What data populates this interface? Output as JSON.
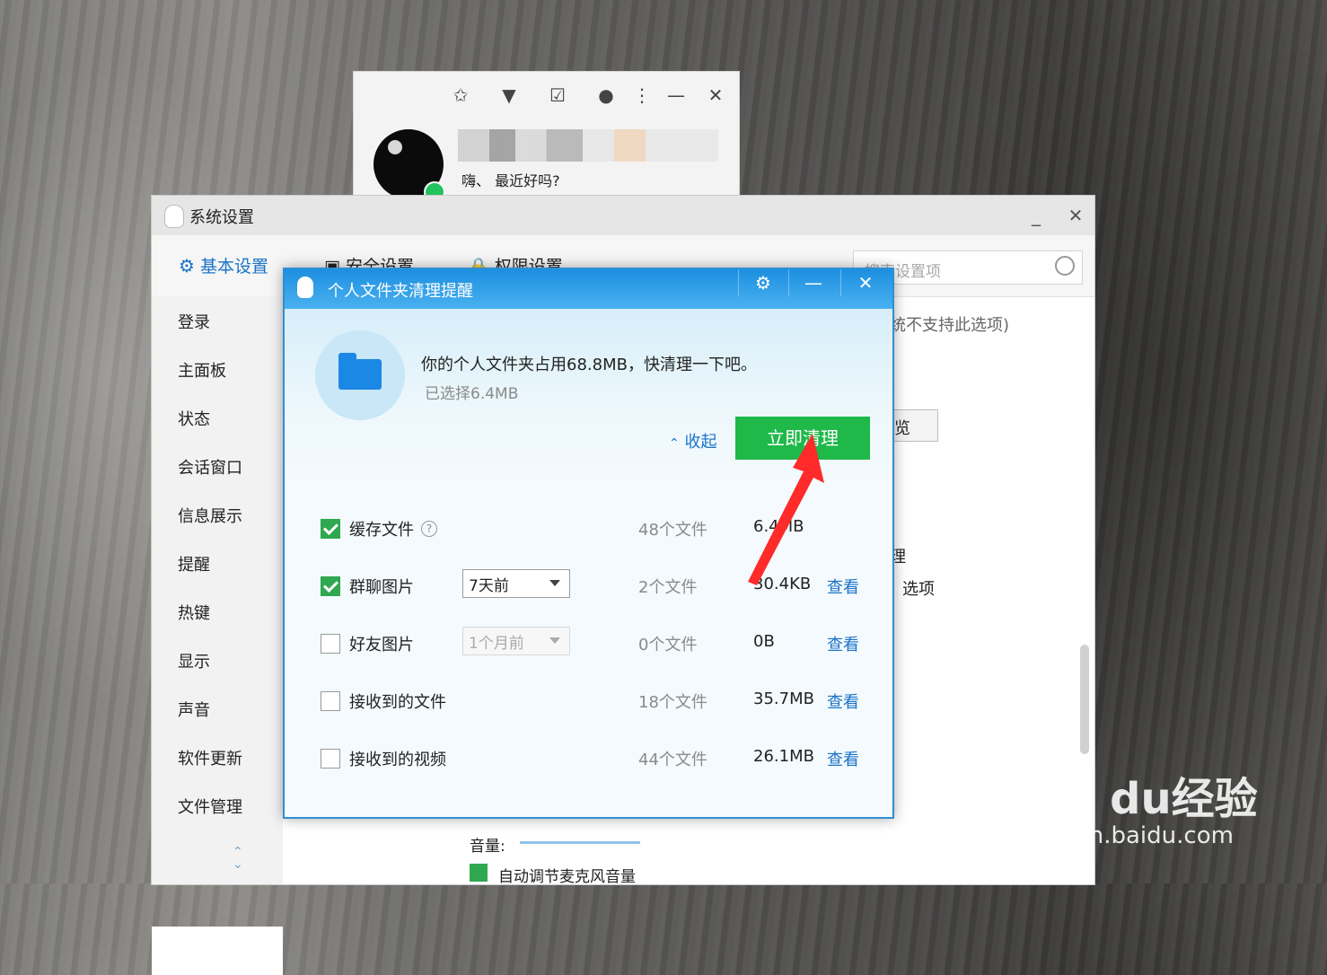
{
  "qq_main": {
    "signature": "嗨、                    最近好吗?"
  },
  "settings": {
    "title": "系统设置",
    "tabs": [
      "基本设置",
      "安全设置",
      "权限设置"
    ],
    "search_placeholder": "搜索设置项",
    "nav": [
      "登录",
      "主面板",
      "状态",
      "会话窗口",
      "信息展示",
      "提醒",
      "热键",
      "显示",
      "声音",
      "软件更新",
      "文件管理"
    ],
    "bg_fragments": {
      "unsupported": "统不支持此选项)",
      "browse": "览",
      "manage": "理",
      "options": "选项",
      "volume": "音量:",
      "auto_mic": "自动调节麦克风音量"
    }
  },
  "dialog": {
    "title": "个人文件夹清理提醒",
    "message": "你的个人文件夹占用68.8MB，快清理一下吧。",
    "selected": "已选择6.4MB",
    "collapse_label": "收起",
    "clean_label": "立即清理",
    "rows": [
      {
        "label": "缓存文件",
        "count": "48个文件",
        "size": "6.4MB",
        "view": "",
        "checked": true
      },
      {
        "label": "群聊图片",
        "dropdown": "7天前",
        "count": "2个文件",
        "size": "30.4KB",
        "view": "查看",
        "checked": true
      },
      {
        "label": "好友图片",
        "dropdown": "1个月前",
        "count": "0个文件",
        "size": "0B",
        "view": "查看",
        "checked": false
      },
      {
        "label": "接收到的文件",
        "count": "18个文件",
        "size": "35.7MB",
        "view": "查看",
        "checked": false
      },
      {
        "label": "接收到的视频",
        "count": "44个文件",
        "size": "26.1MB",
        "view": "查看",
        "checked": false
      }
    ]
  },
  "watermark": {
    "brand": "Bai du经验",
    "url": "jingyan.baidu.com"
  }
}
